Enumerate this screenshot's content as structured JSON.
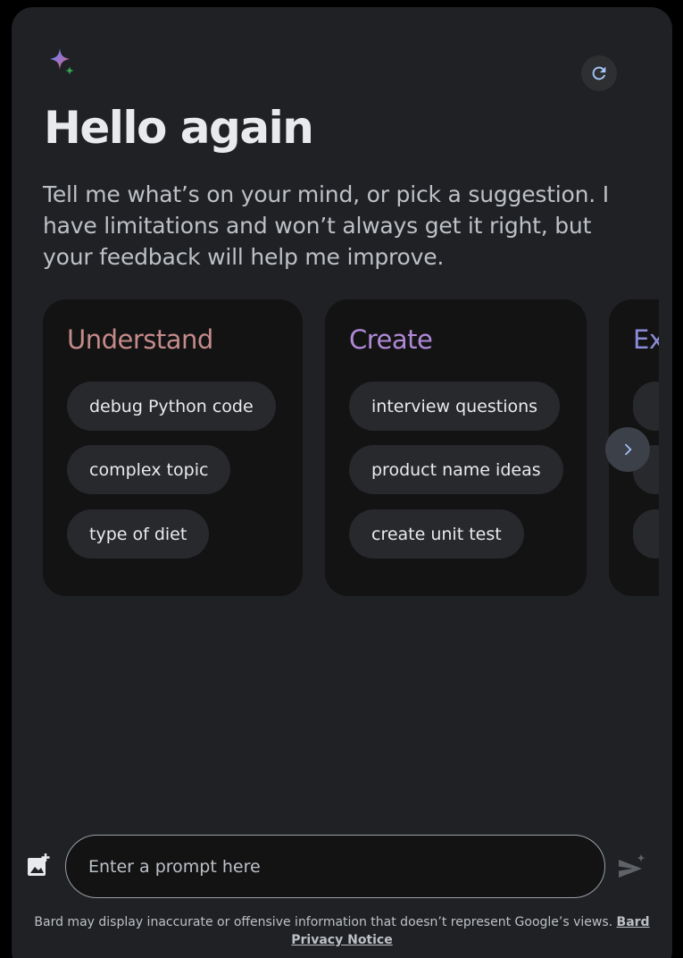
{
  "header": {
    "title": "Hello again",
    "subtitle": "Tell me what’s on your mind, or pick a suggestion. I have limitations and won’t always get it right, but your feedback will help me improve.",
    "logo_icon": "sparkle-icon",
    "refresh_icon": "refresh-icon"
  },
  "cards": [
    {
      "title": "Understand",
      "color": "#c58a8a",
      "chips": [
        "debug Python code",
        "complex topic",
        "type of diet"
      ]
    },
    {
      "title": "Create",
      "color": "#b089d6",
      "chips": [
        "interview questions",
        "product name ideas",
        "create unit test"
      ]
    },
    {
      "title": "Ex",
      "color": "#8b8bd8",
      "chips": [
        "",
        "",
        ""
      ]
    }
  ],
  "carousel": {
    "next_icon": "chevron-right-icon"
  },
  "composer": {
    "placeholder": "Enter a prompt here",
    "upload_icon": "image-upload-icon",
    "send_icon": "send-icon"
  },
  "footer": {
    "disclaimer": "Bard may display inaccurate or offensive information that doesn’t represent Google’s views.",
    "link": "Bard Privacy Notice"
  },
  "colors": {
    "background": "#202124",
    "card": "#131314",
    "chip": "#28292c",
    "accent": "#8ab4f8"
  }
}
